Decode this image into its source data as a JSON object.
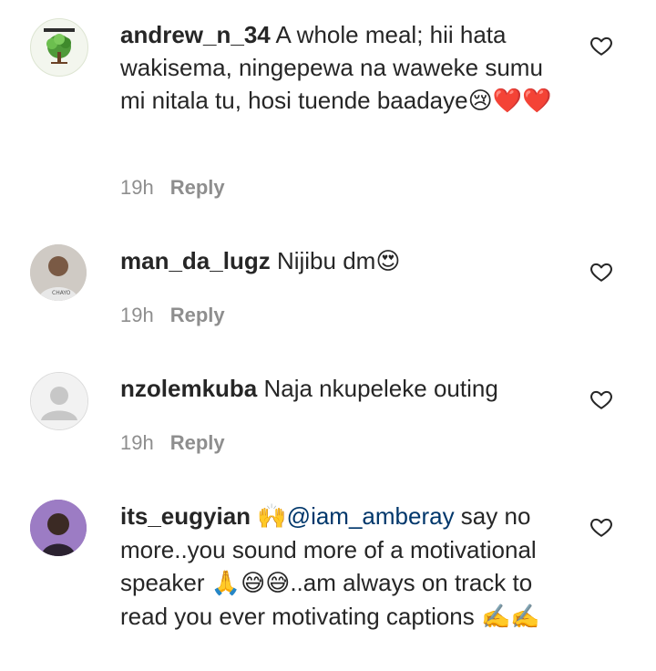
{
  "comments": [
    {
      "username": "andrew_n_34",
      "text": "A whole meal; hii hata wakisema, ningepewa na waweke sumu mi nitala tu, hosi tuende baadaye",
      "emojis": "😢❤️❤️",
      "time": "19h",
      "reply_label": "Reply",
      "avatar_icon": "tree-logo-avatar"
    },
    {
      "username": "man_da_lugz",
      "text": "Nijibu dm",
      "emojis": "😍",
      "time": "19h",
      "reply_label": "Reply",
      "avatar_icon": "photo-avatar"
    },
    {
      "username": "nzolemkuba",
      "text": "Naja nkupeleke outing",
      "emojis": "",
      "time": "19h",
      "reply_label": "Reply",
      "avatar_icon": "default-avatar"
    },
    {
      "username": "its_eugyian",
      "emoji_lead": "🙌",
      "mention": "@iam_amberay",
      "text": " say no more..you sound more of a motivational speaker ",
      "emojis_mid": "🙏😅😅",
      "text_tail": "..am always on track to read you ever motivating captions ",
      "emojis_end": "✍️✍️",
      "avatar_icon": "photo-avatar"
    }
  ],
  "colors": {
    "text": "#262626",
    "muted": "#8e8e8e",
    "mention": "#00376b"
  }
}
